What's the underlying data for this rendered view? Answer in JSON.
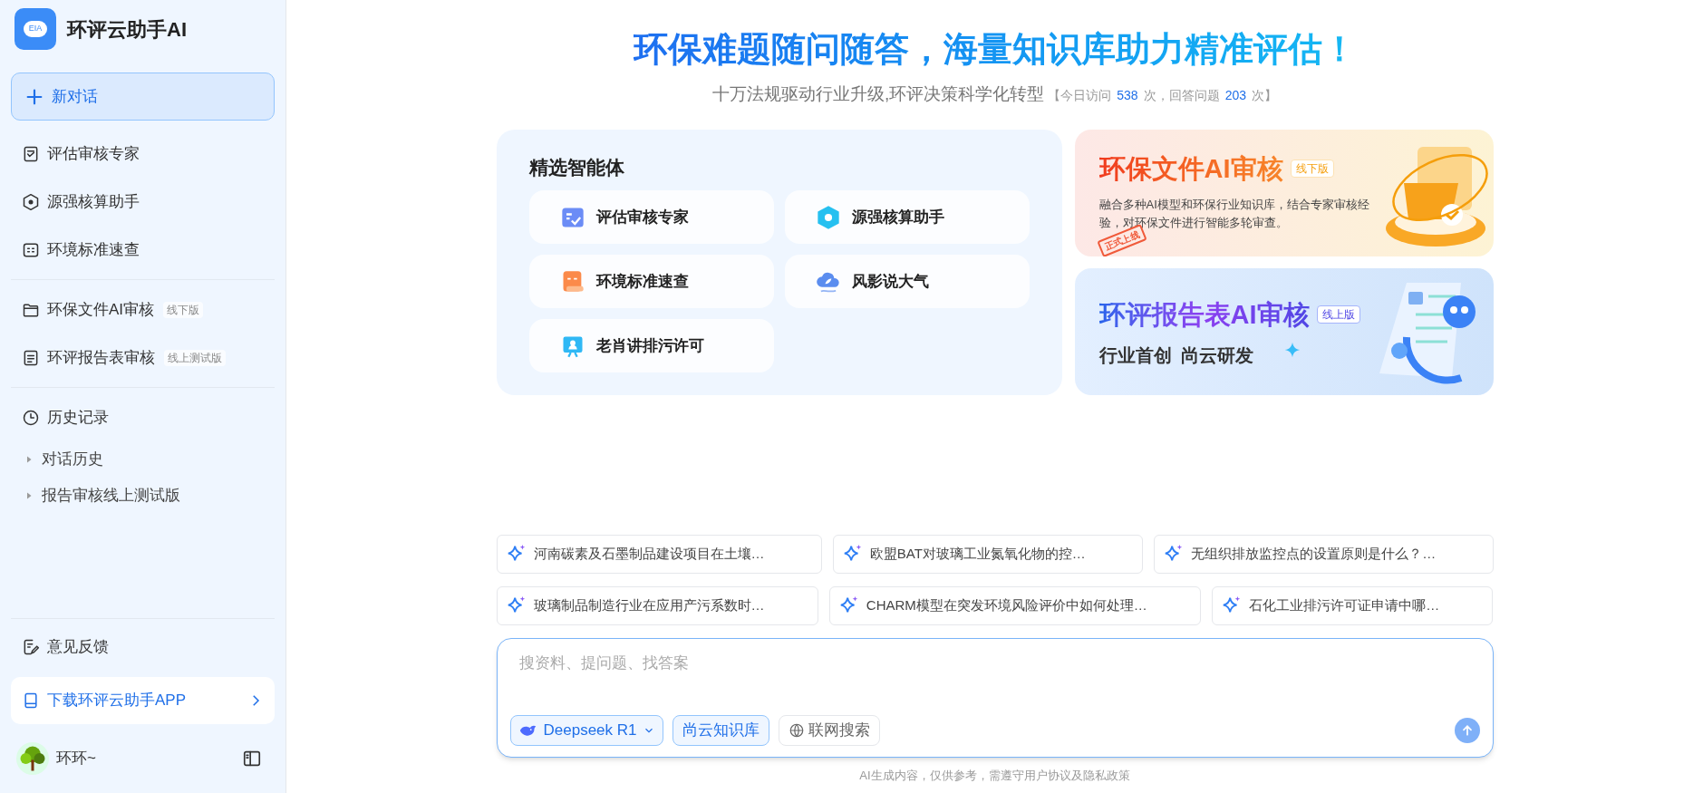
{
  "sidebar": {
    "app_name": "环评云助手AI",
    "logo_text": "EIA",
    "new_chat": {
      "label": "新对话",
      "selected": true
    },
    "groups": [
      [
        {
          "kind": "doc",
          "label": "评估审核专家"
        },
        {
          "kind": "hex",
          "label": "源强核算助手"
        },
        {
          "kind": "gb",
          "label": "环境标准速查"
        }
      ],
      [
        {
          "kind": "folder",
          "label": "环保文件AI审核",
          "badge": "线下版"
        },
        {
          "kind": "lines",
          "label": "环评报告表审核",
          "badge": "线上测试版"
        }
      ],
      [
        {
          "kind": "clock",
          "label": "历史记录",
          "children": [
            {
              "label": "对话历史",
              "expanded": false
            },
            {
              "label": "报告审核线上测试版",
              "expanded": false
            }
          ]
        }
      ]
    ],
    "feedback": "意见反馈",
    "download": "下载环评云助手APP",
    "user": "环环~"
  },
  "main": {
    "headline": "环保难题随问随答，海量知识库助力精准评估！",
    "subtitle": "十万法规驱动行业升级,环评决策科学化转型",
    "stats": [
      {
        "kind": "text",
        "text": "【今日访问"
      },
      {
        "kind": "num",
        "text": "538"
      },
      {
        "kind": "text",
        "text": "次，回答问题"
      },
      {
        "kind": "num",
        "text": "203"
      },
      {
        "kind": "text",
        "text": "次】"
      }
    ],
    "agents": {
      "title": "精选智能体",
      "items": [
        {
          "kind": "doc",
          "label": "评估审核专家"
        },
        {
          "kind": "hex",
          "label": "源强核算助手"
        },
        {
          "kind": "gb",
          "label": "环境标准速查"
        },
        {
          "kind": "cloud",
          "label": "风影说大气"
        },
        {
          "kind": "board",
          "label": "老肖讲排污许可"
        }
      ]
    },
    "banners": [
      {
        "kind": "orange",
        "title": "环保文件AI审核",
        "badge": "线下版",
        "text": "融合多种AI模型和环保行业知识库，结合专家审核经验，对环保文件进行智能多轮审查。",
        "stamp": "正式上线"
      },
      {
        "kind": "blue",
        "title": "环评报告表AI审核",
        "badge": "线上版",
        "text": "行业首创  尚云研发"
      }
    ],
    "suggestions": [
      [
        "河南碳素及石墨制品建设项目在土壤…",
        "欧盟BAT对玻璃工业氮氧化物的控…",
        "无组织排放监控点的设置原则是什么？…"
      ],
      [
        "玻璃制品制造行业在应用产污系数时…",
        "CHARM模型在突发环境风险评价中如何处理…",
        "石化工业排污许可证申请中哪…"
      ]
    ],
    "input": {
      "placeholder": "搜资料、提问题、找答案",
      "model": "Deepseek R1",
      "toggles": [
        {
          "kind": "plain",
          "label": "尚云知识库",
          "selected": true
        },
        {
          "kind": "globe",
          "label": "联网搜索",
          "selected": false
        }
      ]
    },
    "disclaimer": "AI生成内容，仅供参考，需遵守用户协议及隐私政策"
  }
}
